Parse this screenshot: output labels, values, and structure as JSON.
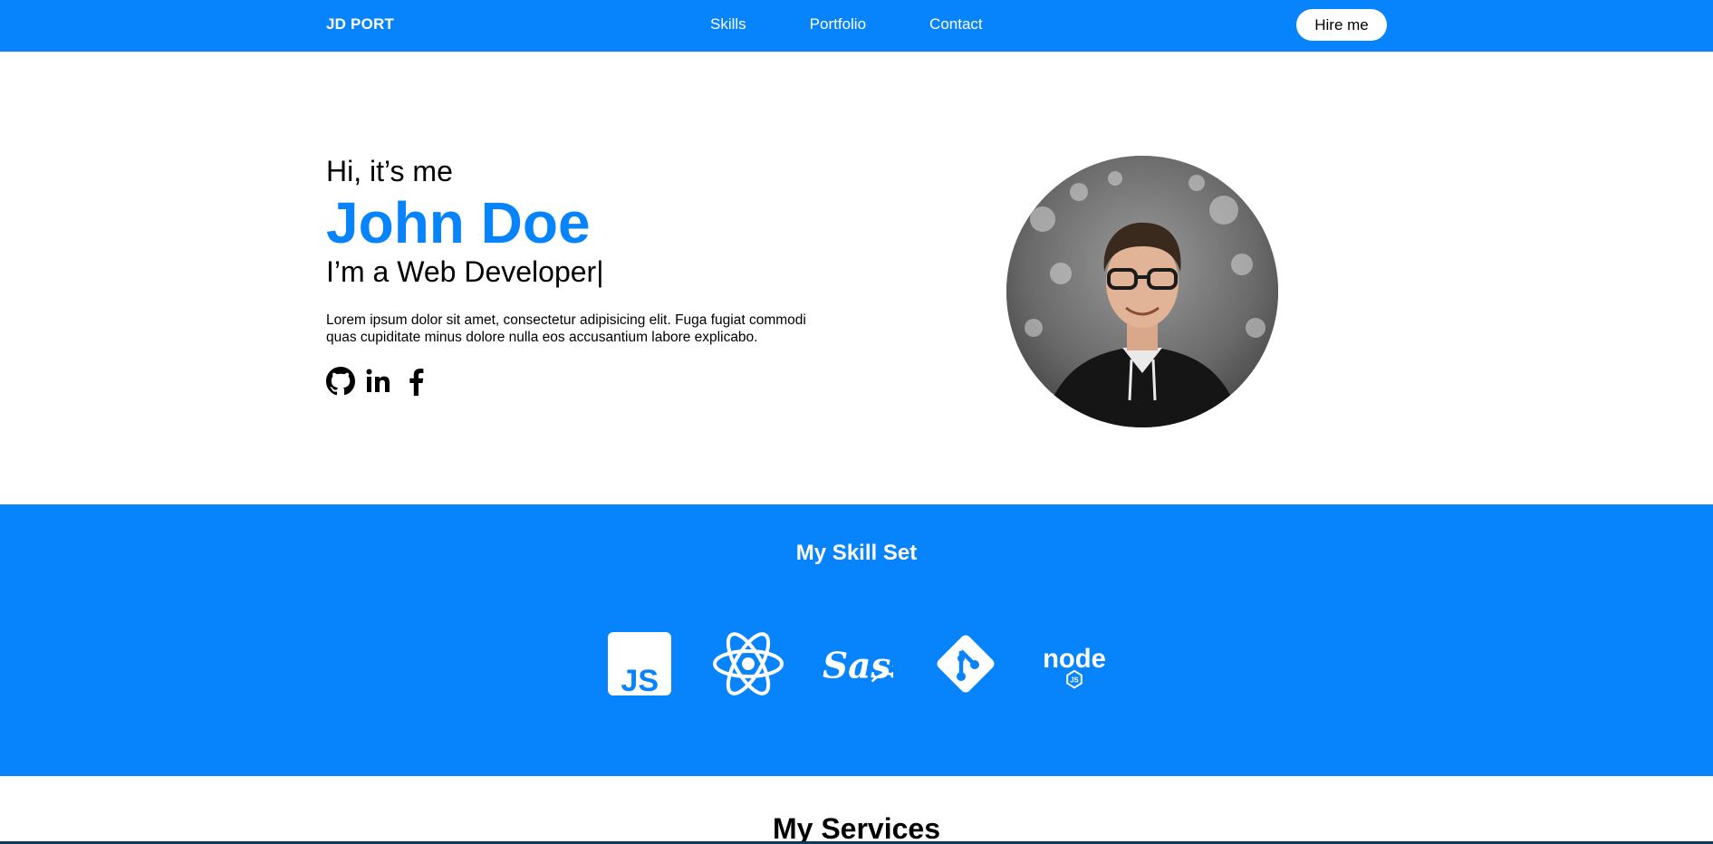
{
  "nav": {
    "brand": "JD PORT",
    "links": [
      "Skills",
      "Portfolio",
      "Contact"
    ],
    "hire_label": "Hire me"
  },
  "hero": {
    "greeting": "Hi, it’s me",
    "name": "John Doe",
    "role": "I’m a Web Developer|",
    "description": "Lorem ipsum dolor sit amet, consectetur adipisicing elit. Fuga fugiat commodi quas cupiditate minus dolore nulla eos accusantium labore explicabo.",
    "socials": [
      "github-icon",
      "linkedin-icon",
      "facebook-icon"
    ],
    "avatar": "profile-photo"
  },
  "skills": {
    "title": "My Skill Set",
    "icons": [
      "javascript-icon",
      "react-icon",
      "sass-icon",
      "git-icon",
      "nodejs-icon"
    ]
  },
  "services": {
    "title": "My Services"
  },
  "colors": {
    "primary": "#0783fb",
    "white": "#ffffff",
    "text": "#000000"
  }
}
